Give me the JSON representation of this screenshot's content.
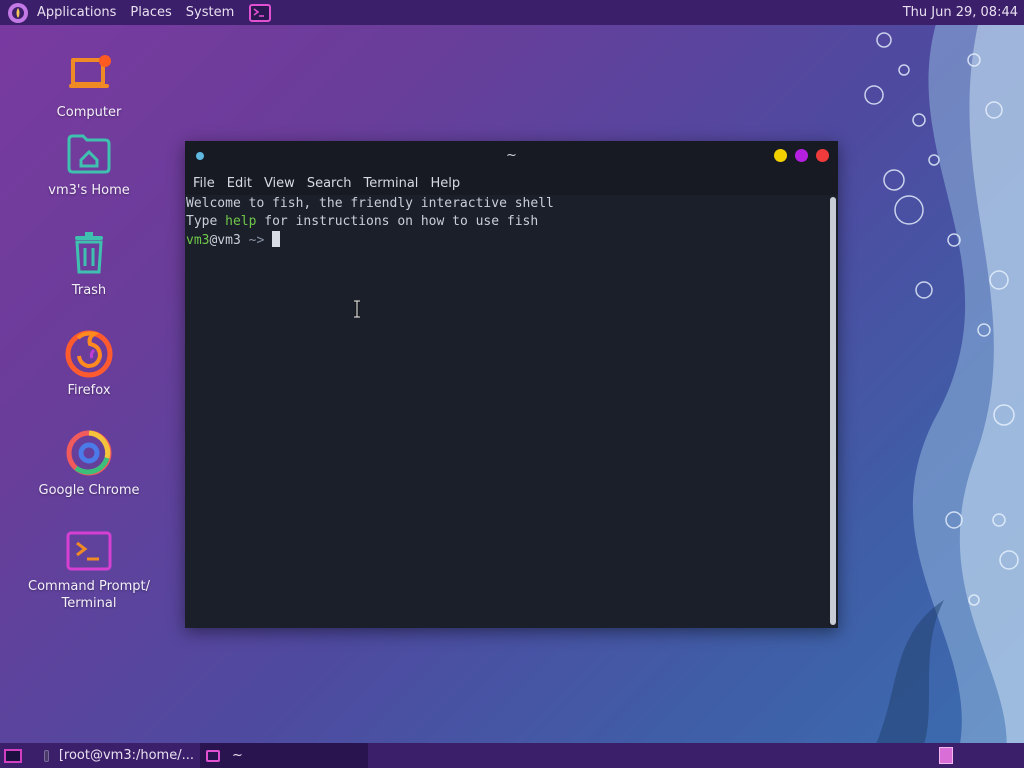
{
  "top_panel": {
    "menus": [
      "Applications",
      "Places",
      "System"
    ],
    "clock": "Thu Jun 29, 08:44"
  },
  "desktop_icons": [
    {
      "label": "Computer",
      "icon": "computer-icon"
    },
    {
      "label": "vm3's Home",
      "icon": "home-folder-icon"
    },
    {
      "label": "Trash",
      "icon": "trash-icon"
    },
    {
      "label": "Firefox",
      "icon": "firefox-icon"
    },
    {
      "label": "Google Chrome",
      "icon": "chrome-icon"
    },
    {
      "label": "Command Prompt/\nTerminal",
      "icon": "terminal-icon"
    }
  ],
  "terminal": {
    "title": "~",
    "menus": [
      "File",
      "Edit",
      "View",
      "Search",
      "Terminal",
      "Help"
    ],
    "lines": {
      "welcome": "Welcome to fish, the friendly interactive shell",
      "help_prefix": "Type ",
      "help_word": "help",
      "help_suffix": " for instructions on how to use fish",
      "prompt_user": "vm3",
      "prompt_host": "@vm3",
      "prompt_arrow": " ~> "
    }
  },
  "taskbar": {
    "tasks": [
      "[root@vm3:/home/...",
      "~"
    ]
  },
  "colors": {
    "panel": "#3c1f6a",
    "terminal_bg": "#1b1f2a",
    "prompt_green": "#6fc84a",
    "accent_magenta": "#e050d0"
  }
}
